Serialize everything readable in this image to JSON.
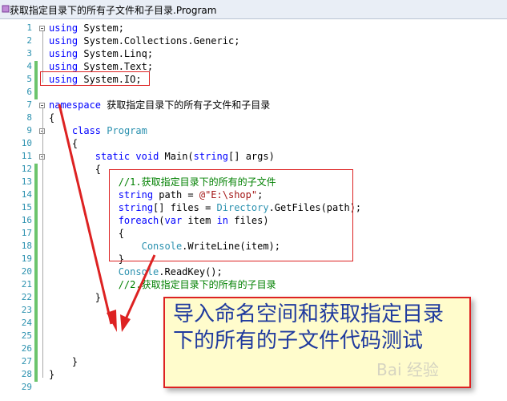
{
  "window": {
    "title": "获取指定目录下的所有子文件和子目录.Program"
  },
  "lines": [
    {
      "n": "1",
      "tokens": [
        {
          "t": "using",
          "c": "kw"
        },
        {
          "t": " System;",
          "c": ""
        }
      ]
    },
    {
      "n": "2",
      "tokens": [
        {
          "t": "using",
          "c": "kw"
        },
        {
          "t": " System.Collections.Generic;",
          "c": ""
        }
      ]
    },
    {
      "n": "3",
      "tokens": [
        {
          "t": "using",
          "c": "kw"
        },
        {
          "t": " System.Linq;",
          "c": ""
        }
      ]
    },
    {
      "n": "4",
      "tokens": [
        {
          "t": "using",
          "c": "kw"
        },
        {
          "t": " System.Text;",
          "c": ""
        }
      ]
    },
    {
      "n": "5",
      "tokens": [
        {
          "t": "using",
          "c": "kw"
        },
        {
          "t": " System.IO;",
          "c": ""
        }
      ]
    },
    {
      "n": "6",
      "tokens": []
    },
    {
      "n": "7",
      "tokens": [
        {
          "t": "namespace",
          "c": "kw"
        },
        {
          "t": " 获取指定目录下的所有子文件和子目录",
          "c": ""
        }
      ]
    },
    {
      "n": "8",
      "tokens": [
        {
          "t": "{",
          "c": ""
        }
      ]
    },
    {
      "n": "9",
      "tokens": [
        {
          "t": "    class",
          "c": "kw"
        },
        {
          "t": " ",
          "c": ""
        },
        {
          "t": "Program",
          "c": "ty"
        }
      ]
    },
    {
      "n": "10",
      "tokens": [
        {
          "t": "    {",
          "c": ""
        }
      ]
    },
    {
      "n": "11",
      "tokens": [
        {
          "t": "        static",
          "c": "kw"
        },
        {
          "t": " ",
          "c": ""
        },
        {
          "t": "void",
          "c": "kw"
        },
        {
          "t": " Main(",
          "c": ""
        },
        {
          "t": "string",
          "c": "kw"
        },
        {
          "t": "[] args)",
          "c": ""
        }
      ]
    },
    {
      "n": "12",
      "tokens": [
        {
          "t": "        {",
          "c": ""
        }
      ]
    },
    {
      "n": "13",
      "tokens": [
        {
          "t": "            //1.获取指定目录下的所有的子文件",
          "c": "cm"
        }
      ]
    },
    {
      "n": "14",
      "tokens": [
        {
          "t": "            string",
          "c": "kw"
        },
        {
          "t": " path = ",
          "c": ""
        },
        {
          "t": "@\"E:\\shop\"",
          "c": "st"
        },
        {
          "t": ";",
          "c": ""
        }
      ]
    },
    {
      "n": "15",
      "tokens": [
        {
          "t": "            string",
          "c": "kw"
        },
        {
          "t": "[] files = ",
          "c": ""
        },
        {
          "t": "Directory",
          "c": "ty"
        },
        {
          "t": ".GetFiles(path);",
          "c": ""
        }
      ]
    },
    {
      "n": "16",
      "tokens": [
        {
          "t": "            foreach",
          "c": "kw"
        },
        {
          "t": "(",
          "c": ""
        },
        {
          "t": "var",
          "c": "kw"
        },
        {
          "t": " item ",
          "c": ""
        },
        {
          "t": "in",
          "c": "kw"
        },
        {
          "t": " files)",
          "c": ""
        }
      ]
    },
    {
      "n": "17",
      "tokens": [
        {
          "t": "            {",
          "c": ""
        }
      ]
    },
    {
      "n": "18",
      "tokens": [
        {
          "t": "                ",
          "c": ""
        },
        {
          "t": "Console",
          "c": "ty"
        },
        {
          "t": ".WriteLine(item);",
          "c": ""
        }
      ]
    },
    {
      "n": "19",
      "tokens": [
        {
          "t": "            }",
          "c": ""
        }
      ]
    },
    {
      "n": "20",
      "tokens": [
        {
          "t": "            ",
          "c": ""
        },
        {
          "t": "Console",
          "c": "ty"
        },
        {
          "t": ".ReadKey();",
          "c": ""
        }
      ]
    },
    {
      "n": "21",
      "tokens": [
        {
          "t": "            //2.获取指定目录下的所有的子目录",
          "c": "cm"
        }
      ]
    },
    {
      "n": "22",
      "tokens": [
        {
          "t": "        }",
          "c": ""
        }
      ]
    },
    {
      "n": "23",
      "tokens": []
    },
    {
      "n": "24",
      "tokens": []
    },
    {
      "n": "25",
      "tokens": []
    },
    {
      "n": "26",
      "tokens": []
    },
    {
      "n": "27",
      "tokens": [
        {
          "t": "    }",
          "c": ""
        }
      ]
    },
    {
      "n": "28",
      "tokens": [
        {
          "t": "}",
          "c": ""
        }
      ]
    },
    {
      "n": "29",
      "tokens": []
    }
  ],
  "caption": {
    "text": "导入命名空间和获取指定目录下的所有的子文件代码测试"
  },
  "watermark": {
    "text": "Bai 经验"
  },
  "colors": {
    "annotation_red": "#dd2222",
    "caption_bg": "#fffccc",
    "caption_text": "#1f3a9e",
    "change_bar": "#6cc46c"
  }
}
